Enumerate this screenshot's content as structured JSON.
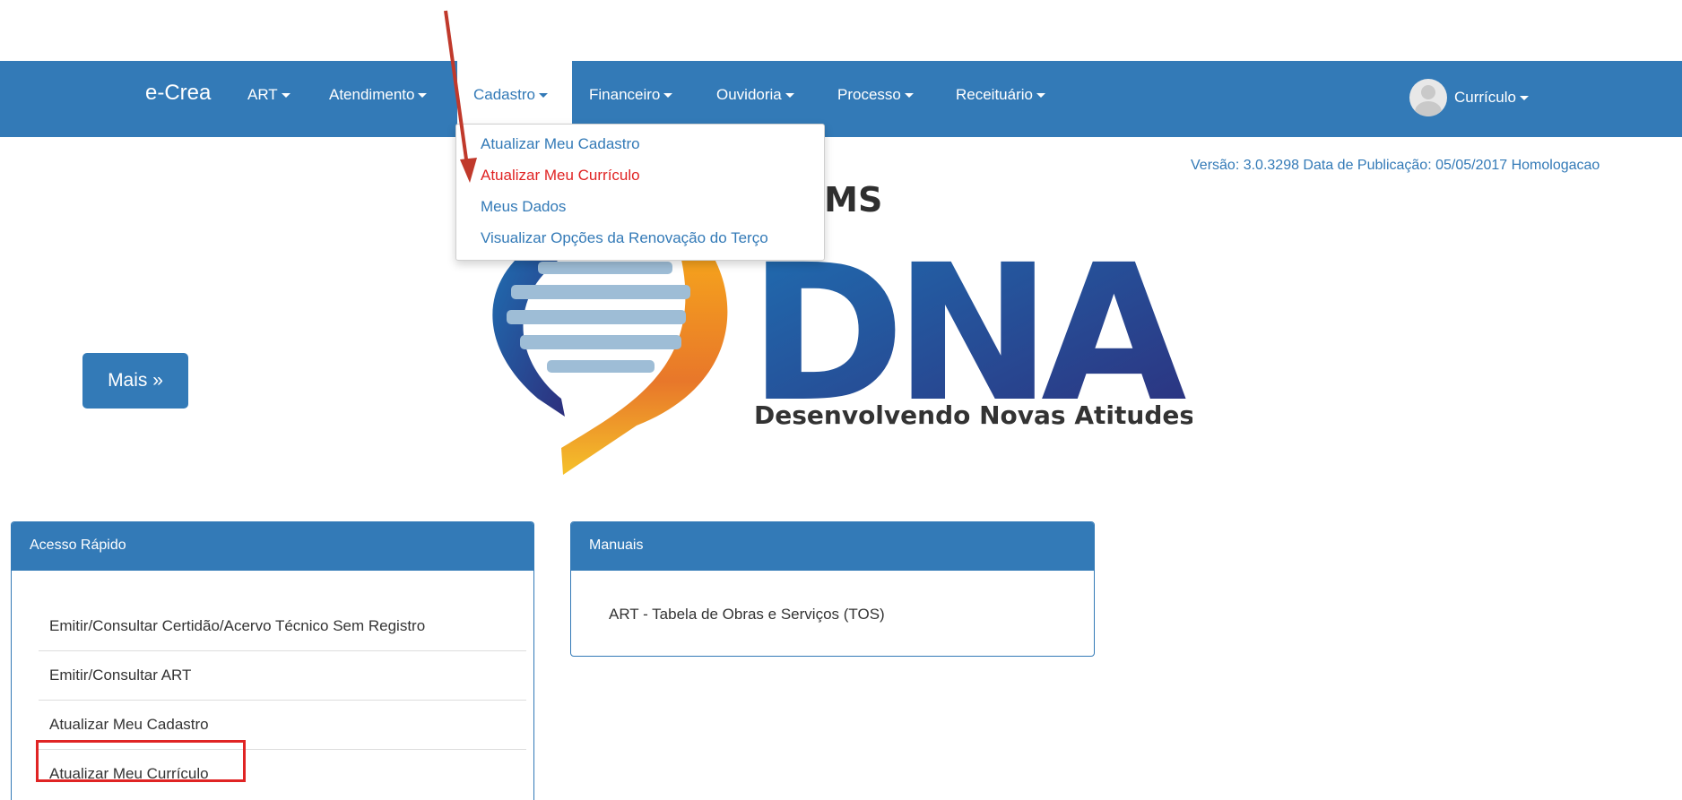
{
  "navbar": {
    "brand": "e-Crea",
    "items": [
      {
        "label": "ART"
      },
      {
        "label": "Atendimento"
      },
      {
        "label": "Cadastro"
      },
      {
        "label": "Financeiro"
      },
      {
        "label": "Ouvidoria"
      },
      {
        "label": "Processo"
      },
      {
        "label": "Receituário"
      }
    ],
    "user": {
      "label": "Currículo"
    }
  },
  "cadastro_menu": {
    "items": [
      {
        "label": "Atualizar Meu Cadastro"
      },
      {
        "label": "Atualizar Meu Currículo"
      },
      {
        "label": "Meus Dados"
      },
      {
        "label": "Visualizar Opções da Renovação do Terço"
      }
    ]
  },
  "version_text": "Versão: 3.0.3298 Data de Publicação: 05/05/2017 Homologacao",
  "logo": {
    "heading": "EA-MS",
    "wordmark": "DNA",
    "tagline": "Desenvolvendo Novas Atitudes"
  },
  "more_button": "Mais »",
  "quick_access": {
    "title": "Acesso Rápido",
    "items": [
      {
        "label": "Emitir/Consultar Certidão/Acervo Técnico Sem Registro"
      },
      {
        "label": "Emitir/Consultar ART"
      },
      {
        "label": "Atualizar Meu Cadastro"
      },
      {
        "label": "Atualizar Meu Currículo"
      }
    ]
  },
  "manuals": {
    "title": "Manuais",
    "items": [
      {
        "label": "ART - Tabela de Obras e Serviços (TOS)"
      }
    ]
  },
  "colors": {
    "primary": "#337ab7",
    "highlight": "#e02424",
    "annotation_arrow": "#c0392b"
  }
}
